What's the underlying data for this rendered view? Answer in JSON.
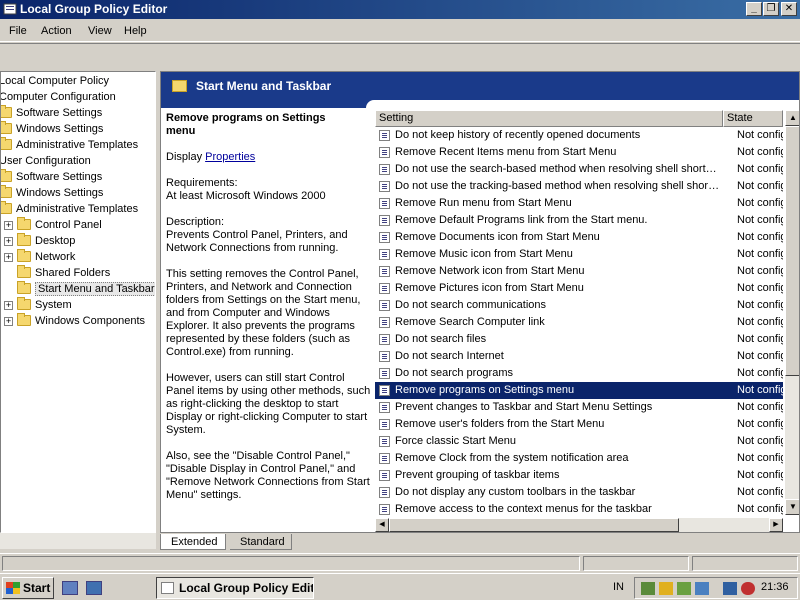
{
  "window": {
    "title": "Local Group Policy Editor",
    "min_label": "_",
    "max_label": "❐",
    "close_label": "✕"
  },
  "menu": [
    "File",
    "Action",
    "View",
    "Help"
  ],
  "tree": [
    {
      "label": "Local Computer Policy",
      "expander": "",
      "folder": false
    },
    {
      "label": "Computer Configuration",
      "expander": "",
      "folder": false
    },
    {
      "label": "Software Settings",
      "expander": "",
      "folder": true
    },
    {
      "label": "Windows Settings",
      "expander": "",
      "folder": true
    },
    {
      "label": "Administrative Templates",
      "expander": "",
      "folder": true
    },
    {
      "label": "User Configuration",
      "expander": "",
      "folder": false
    },
    {
      "label": "Software Settings",
      "expander": "",
      "folder": true
    },
    {
      "label": "Windows Settings",
      "expander": "",
      "folder": true
    },
    {
      "label": "Administrative Templates",
      "expander": "",
      "folder": true
    },
    {
      "label": "Control Panel",
      "expander": "+",
      "folder": true
    },
    {
      "label": "Desktop",
      "expander": "+",
      "folder": true
    },
    {
      "label": "Network",
      "expander": "+",
      "folder": true
    },
    {
      "label": "Shared Folders",
      "expander": "",
      "folder": true
    },
    {
      "label": "Start Menu and Taskbar",
      "expander": "",
      "folder": true,
      "selected": true
    },
    {
      "label": "System",
      "expander": "+",
      "folder": true
    },
    {
      "label": "Windows Components",
      "expander": "+",
      "folder": true
    }
  ],
  "banner_title": "Start Menu and Taskbar",
  "description": {
    "title": "Remove programs on Settings menu",
    "display_prefix": "Display ",
    "display_link": "Properties",
    "requirements": "Requirements:\nAt least Microsoft Windows 2000",
    "description": "Description:\nPrevents Control Panel, Printers, and Network Connections from running.",
    "body1": "This setting removes the Control Panel, Printers, and Network and Connection folders from Settings on the Start menu, and from Computer and Windows Explorer. It also prevents the programs represented by these folders (such as Control.exe) from running.",
    "body2": "However, users can still start Control Panel items by using other methods, such as right-clicking the desktop to start Display or right-clicking Computer to start System.",
    "body3": "Also, see the \"Disable Control Panel,\" \"Disable Display in Control Panel,\" and \"Remove Network Connections from Start Menu\" settings."
  },
  "list": {
    "col_setting": "Setting",
    "col_state": "State",
    "rows": [
      {
        "name": "Do not keep history of recently opened documents",
        "state": "Not configured"
      },
      {
        "name": "Remove Recent Items menu from Start Menu",
        "state": "Not configured"
      },
      {
        "name": "Do not use the search-based method when resolving shell shortcuts",
        "state": "Not configured"
      },
      {
        "name": "Do not use the tracking-based method when resolving shell shortcuts",
        "state": "Not configured"
      },
      {
        "name": "Remove Run menu from Start Menu",
        "state": "Not configured"
      },
      {
        "name": "Remove Default Programs link from the Start menu.",
        "state": "Not configured"
      },
      {
        "name": "Remove Documents icon from Start Menu",
        "state": "Not configured"
      },
      {
        "name": "Remove Music icon from Start Menu",
        "state": "Not configured"
      },
      {
        "name": "Remove Network icon from Start Menu",
        "state": "Not configured"
      },
      {
        "name": "Remove Pictures icon from Start Menu",
        "state": "Not configured"
      },
      {
        "name": "Do not search communications",
        "state": "Not configured"
      },
      {
        "name": "Remove Search Computer link",
        "state": "Not configured"
      },
      {
        "name": "Do not search files",
        "state": "Not configured"
      },
      {
        "name": "Do not search Internet",
        "state": "Not configured"
      },
      {
        "name": "Do not search programs",
        "state": "Not configured"
      },
      {
        "name": "Remove programs on Settings menu",
        "state": "Not configured",
        "selected": true
      },
      {
        "name": "Prevent changes to Taskbar and Start Menu Settings",
        "state": "Not configured"
      },
      {
        "name": "Remove user's folders from the Start Menu",
        "state": "Not configured"
      },
      {
        "name": "Force classic Start Menu",
        "state": "Not configured"
      },
      {
        "name": "Remove Clock from the system notification area",
        "state": "Not configured"
      },
      {
        "name": "Prevent grouping of taskbar items",
        "state": "Not configured"
      },
      {
        "name": "Do not display any custom toolbars in the taskbar",
        "state": "Not configured"
      },
      {
        "name": "Remove access to the context menus for the taskbar",
        "state": "Not configured"
      }
    ]
  },
  "tabs": {
    "extended": "Extended",
    "standard": "Standard"
  },
  "taskbar": {
    "start": "Start",
    "task_item": "Local Group Policy Edit...",
    "lang": "IN",
    "clock": "21:36"
  },
  "colors": {
    "title_gradient_start": "#0a246a",
    "selection": "#0a246a",
    "banner": "#1a3a8a"
  }
}
